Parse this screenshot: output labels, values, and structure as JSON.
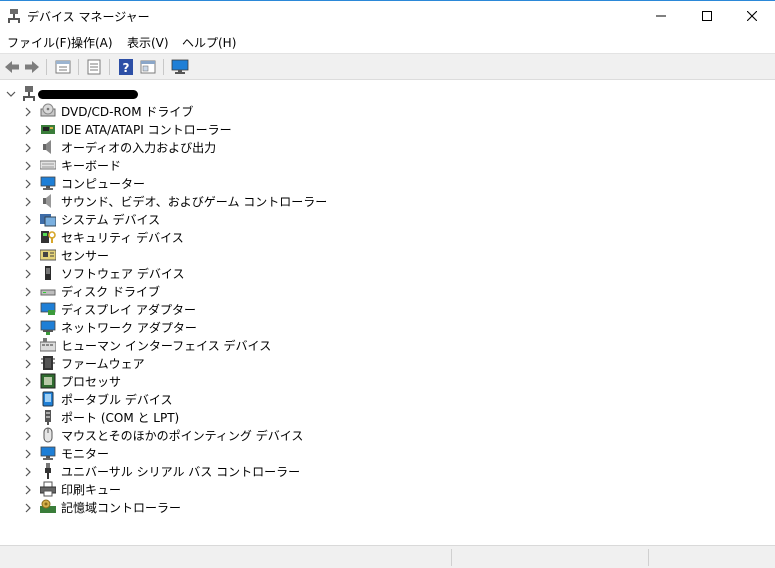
{
  "window": {
    "title": "デバイス マネージャー"
  },
  "menu": [
    "ファイル(F)",
    "操作(A)",
    "表示(V)",
    "ヘルプ(H)"
  ],
  "toolbar": {
    "icons": [
      "back-arrow-icon",
      "forward-arrow-icon",
      "properties-icon",
      "list-view-icon",
      "help-icon",
      "panel-icon",
      "monitor-icon"
    ]
  },
  "tree": {
    "root_label": "DESKTOP-[redacted]",
    "categories": [
      {
        "label": "DVD/CD-ROM ドライブ",
        "icon": "dvd-drive-icon"
      },
      {
        "label": "IDE ATA/ATAPI コントローラー",
        "icon": "ide-controller-icon"
      },
      {
        "label": "オーディオの入力および出力",
        "icon": "speaker-icon"
      },
      {
        "label": "キーボード",
        "icon": "keyboard-icon"
      },
      {
        "label": "コンピューター",
        "icon": "computer-icon"
      },
      {
        "label": "サウンド、ビデオ、およびゲーム コントローラー",
        "icon": "sound-icon"
      },
      {
        "label": "システム デバイス",
        "icon": "system-device-icon"
      },
      {
        "label": "セキュリティ デバイス",
        "icon": "security-device-icon"
      },
      {
        "label": "センサー",
        "icon": "sensor-icon"
      },
      {
        "label": "ソフトウェア デバイス",
        "icon": "software-device-icon"
      },
      {
        "label": "ディスク ドライブ",
        "icon": "disk-drive-icon"
      },
      {
        "label": "ディスプレイ アダプター",
        "icon": "display-adapter-icon"
      },
      {
        "label": "ネットワーク アダプター",
        "icon": "network-adapter-icon"
      },
      {
        "label": "ヒューマン インターフェイス デバイス",
        "icon": "hid-icon"
      },
      {
        "label": "ファームウェア",
        "icon": "firmware-icon"
      },
      {
        "label": "プロセッサ",
        "icon": "processor-icon"
      },
      {
        "label": "ポータブル デバイス",
        "icon": "portable-device-icon"
      },
      {
        "label": "ポート (COM と LPT)",
        "icon": "port-icon"
      },
      {
        "label": "マウスとそのほかのポインティング デバイス",
        "icon": "mouse-icon"
      },
      {
        "label": "モニター",
        "icon": "monitor-icon"
      },
      {
        "label": "ユニバーサル シリアル バス コントローラー",
        "icon": "usb-icon"
      },
      {
        "label": "印刷キュー",
        "icon": "printer-icon"
      },
      {
        "label": "記憶域コントローラー",
        "icon": "storage-controller-icon"
      }
    ]
  }
}
